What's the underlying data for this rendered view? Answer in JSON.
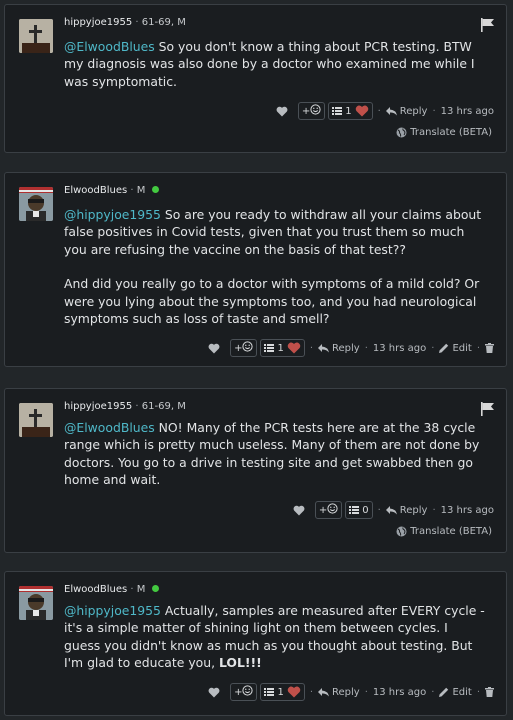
{
  "comments": [
    {
      "username": "hippyjoe1955",
      "details": "61-69, M",
      "mention": "@ElwoodBlues",
      "text": " So you don't know a thing about PCR testing. BTW my diagnosis was also done by a doctor who examined me while I was symptomatic.",
      "vote_count": "1",
      "reply_label": "Reply",
      "time": "13 hrs ago",
      "translate_label": "Translate (BETA)"
    },
    {
      "username": "ElwoodBlues",
      "details": "M",
      "mention": "@hippyjoe1955",
      "text": " So are you ready to withdraw all your claims about false positives in Covid tests, given that you trust them so much you are refusing the vaccine on the basis of that test??",
      "text2": "And did you really go to a doctor with symptoms of a mild cold? Or were you lying about the symptoms too, and you had neurological symptoms such as loss of taste and smell?",
      "vote_count": "1",
      "reply_label": "Reply",
      "time": "13 hrs ago",
      "edit_label": "Edit"
    },
    {
      "username": "hippyjoe1955",
      "details": "61-69, M",
      "mention": "@ElwoodBlues",
      "text": " NO! Many of the PCR tests here are at the 38 cycle range which is pretty much useless. Many of them are not done by doctors. You go to a drive in testing site and get swabbed then go home and wait.",
      "vote_count": "0",
      "reply_label": "Reply",
      "time": "13 hrs ago",
      "translate_label": "Translate (BETA)"
    },
    {
      "username": "ElwoodBlues",
      "details": "M",
      "mention": "@hippyjoe1955",
      "text": " Actually, samples are measured after EVERY cycle - it's a simple matter of shining light on them between cycles. I guess you didn't know as much as you thought about testing. But I'm glad to educate you, ",
      "text_bold": "LOL!!!",
      "vote_count": "1",
      "reply_label": "Reply",
      "time": "13 hrs ago",
      "edit_label": "Edit"
    }
  ],
  "plus_label": "+",
  "separator": "·",
  "colors": {
    "background": "#222629",
    "card": "#1a1d20",
    "mention": "#4fb8c8",
    "online": "#43c940",
    "heart": "#c0504a"
  },
  "icons": [
    "heart-outline-icon",
    "smiley-icon",
    "list-icon",
    "heart-icon",
    "reply-icon",
    "globe-icon",
    "pencil-icon",
    "trash-icon",
    "flag-icon",
    "online-dot-icon"
  ]
}
